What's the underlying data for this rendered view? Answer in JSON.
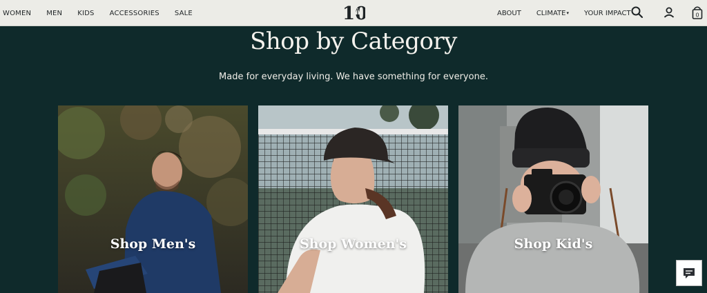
{
  "header": {
    "logo_text": "10",
    "left_nav": [
      "WOMEN",
      "MEN",
      "KIDS",
      "ACCESSORIES",
      "SALE"
    ],
    "right_nav": [
      {
        "label": "ABOUT",
        "dropdown": false
      },
      {
        "label": "CLIMATE",
        "dropdown": true
      },
      {
        "label": "YOUR IMPACT",
        "dropdown": false
      }
    ],
    "icons": [
      "search-icon",
      "account-icon",
      "cart-icon"
    ],
    "cart_count": "0"
  },
  "hero": {
    "title": "Shop by Category",
    "subtitle": "Made for everyday living. We have something for everyone."
  },
  "categories": [
    {
      "label": "Shop Men's"
    },
    {
      "label": "Shop Women's"
    },
    {
      "label": "Shop Kid's"
    }
  ],
  "chat": {
    "icon": "chat-icon"
  },
  "colors": {
    "background": "#0f2a2b",
    "header": "#ecece7",
    "text_light": "#f5f3ee"
  }
}
